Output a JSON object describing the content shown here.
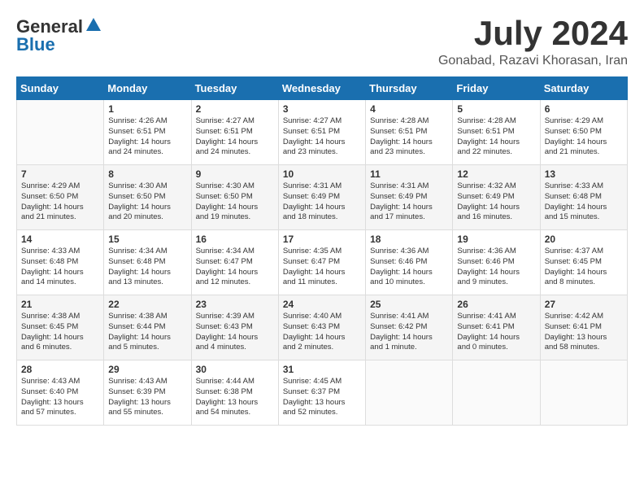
{
  "header": {
    "logo_general": "General",
    "logo_blue": "Blue",
    "month": "July 2024",
    "location": "Gonabad, Razavi Khorasan, Iran"
  },
  "weekdays": [
    "Sunday",
    "Monday",
    "Tuesday",
    "Wednesday",
    "Thursday",
    "Friday",
    "Saturday"
  ],
  "weeks": [
    [
      {
        "day": "",
        "info": ""
      },
      {
        "day": "1",
        "info": "Sunrise: 4:26 AM\nSunset: 6:51 PM\nDaylight: 14 hours\nand 24 minutes."
      },
      {
        "day": "2",
        "info": "Sunrise: 4:27 AM\nSunset: 6:51 PM\nDaylight: 14 hours\nand 24 minutes."
      },
      {
        "day": "3",
        "info": "Sunrise: 4:27 AM\nSunset: 6:51 PM\nDaylight: 14 hours\nand 23 minutes."
      },
      {
        "day": "4",
        "info": "Sunrise: 4:28 AM\nSunset: 6:51 PM\nDaylight: 14 hours\nand 23 minutes."
      },
      {
        "day": "5",
        "info": "Sunrise: 4:28 AM\nSunset: 6:51 PM\nDaylight: 14 hours\nand 22 minutes."
      },
      {
        "day": "6",
        "info": "Sunrise: 4:29 AM\nSunset: 6:50 PM\nDaylight: 14 hours\nand 21 minutes."
      }
    ],
    [
      {
        "day": "7",
        "info": "Sunrise: 4:29 AM\nSunset: 6:50 PM\nDaylight: 14 hours\nand 21 minutes."
      },
      {
        "day": "8",
        "info": "Sunrise: 4:30 AM\nSunset: 6:50 PM\nDaylight: 14 hours\nand 20 minutes."
      },
      {
        "day": "9",
        "info": "Sunrise: 4:30 AM\nSunset: 6:50 PM\nDaylight: 14 hours\nand 19 minutes."
      },
      {
        "day": "10",
        "info": "Sunrise: 4:31 AM\nSunset: 6:49 PM\nDaylight: 14 hours\nand 18 minutes."
      },
      {
        "day": "11",
        "info": "Sunrise: 4:31 AM\nSunset: 6:49 PM\nDaylight: 14 hours\nand 17 minutes."
      },
      {
        "day": "12",
        "info": "Sunrise: 4:32 AM\nSunset: 6:49 PM\nDaylight: 14 hours\nand 16 minutes."
      },
      {
        "day": "13",
        "info": "Sunrise: 4:33 AM\nSunset: 6:48 PM\nDaylight: 14 hours\nand 15 minutes."
      }
    ],
    [
      {
        "day": "14",
        "info": "Sunrise: 4:33 AM\nSunset: 6:48 PM\nDaylight: 14 hours\nand 14 minutes."
      },
      {
        "day": "15",
        "info": "Sunrise: 4:34 AM\nSunset: 6:48 PM\nDaylight: 14 hours\nand 13 minutes."
      },
      {
        "day": "16",
        "info": "Sunrise: 4:34 AM\nSunset: 6:47 PM\nDaylight: 14 hours\nand 12 minutes."
      },
      {
        "day": "17",
        "info": "Sunrise: 4:35 AM\nSunset: 6:47 PM\nDaylight: 14 hours\nand 11 minutes."
      },
      {
        "day": "18",
        "info": "Sunrise: 4:36 AM\nSunset: 6:46 PM\nDaylight: 14 hours\nand 10 minutes."
      },
      {
        "day": "19",
        "info": "Sunrise: 4:36 AM\nSunset: 6:46 PM\nDaylight: 14 hours\nand 9 minutes."
      },
      {
        "day": "20",
        "info": "Sunrise: 4:37 AM\nSunset: 6:45 PM\nDaylight: 14 hours\nand 8 minutes."
      }
    ],
    [
      {
        "day": "21",
        "info": "Sunrise: 4:38 AM\nSunset: 6:45 PM\nDaylight: 14 hours\nand 6 minutes."
      },
      {
        "day": "22",
        "info": "Sunrise: 4:38 AM\nSunset: 6:44 PM\nDaylight: 14 hours\nand 5 minutes."
      },
      {
        "day": "23",
        "info": "Sunrise: 4:39 AM\nSunset: 6:43 PM\nDaylight: 14 hours\nand 4 minutes."
      },
      {
        "day": "24",
        "info": "Sunrise: 4:40 AM\nSunset: 6:43 PM\nDaylight: 14 hours\nand 2 minutes."
      },
      {
        "day": "25",
        "info": "Sunrise: 4:41 AM\nSunset: 6:42 PM\nDaylight: 14 hours\nand 1 minute."
      },
      {
        "day": "26",
        "info": "Sunrise: 4:41 AM\nSunset: 6:41 PM\nDaylight: 14 hours\nand 0 minutes."
      },
      {
        "day": "27",
        "info": "Sunrise: 4:42 AM\nSunset: 6:41 PM\nDaylight: 13 hours\nand 58 minutes."
      }
    ],
    [
      {
        "day": "28",
        "info": "Sunrise: 4:43 AM\nSunset: 6:40 PM\nDaylight: 13 hours\nand 57 minutes."
      },
      {
        "day": "29",
        "info": "Sunrise: 4:43 AM\nSunset: 6:39 PM\nDaylight: 13 hours\nand 55 minutes."
      },
      {
        "day": "30",
        "info": "Sunrise: 4:44 AM\nSunset: 6:38 PM\nDaylight: 13 hours\nand 54 minutes."
      },
      {
        "day": "31",
        "info": "Sunrise: 4:45 AM\nSunset: 6:37 PM\nDaylight: 13 hours\nand 52 minutes."
      },
      {
        "day": "",
        "info": ""
      },
      {
        "day": "",
        "info": ""
      },
      {
        "day": "",
        "info": ""
      }
    ]
  ]
}
